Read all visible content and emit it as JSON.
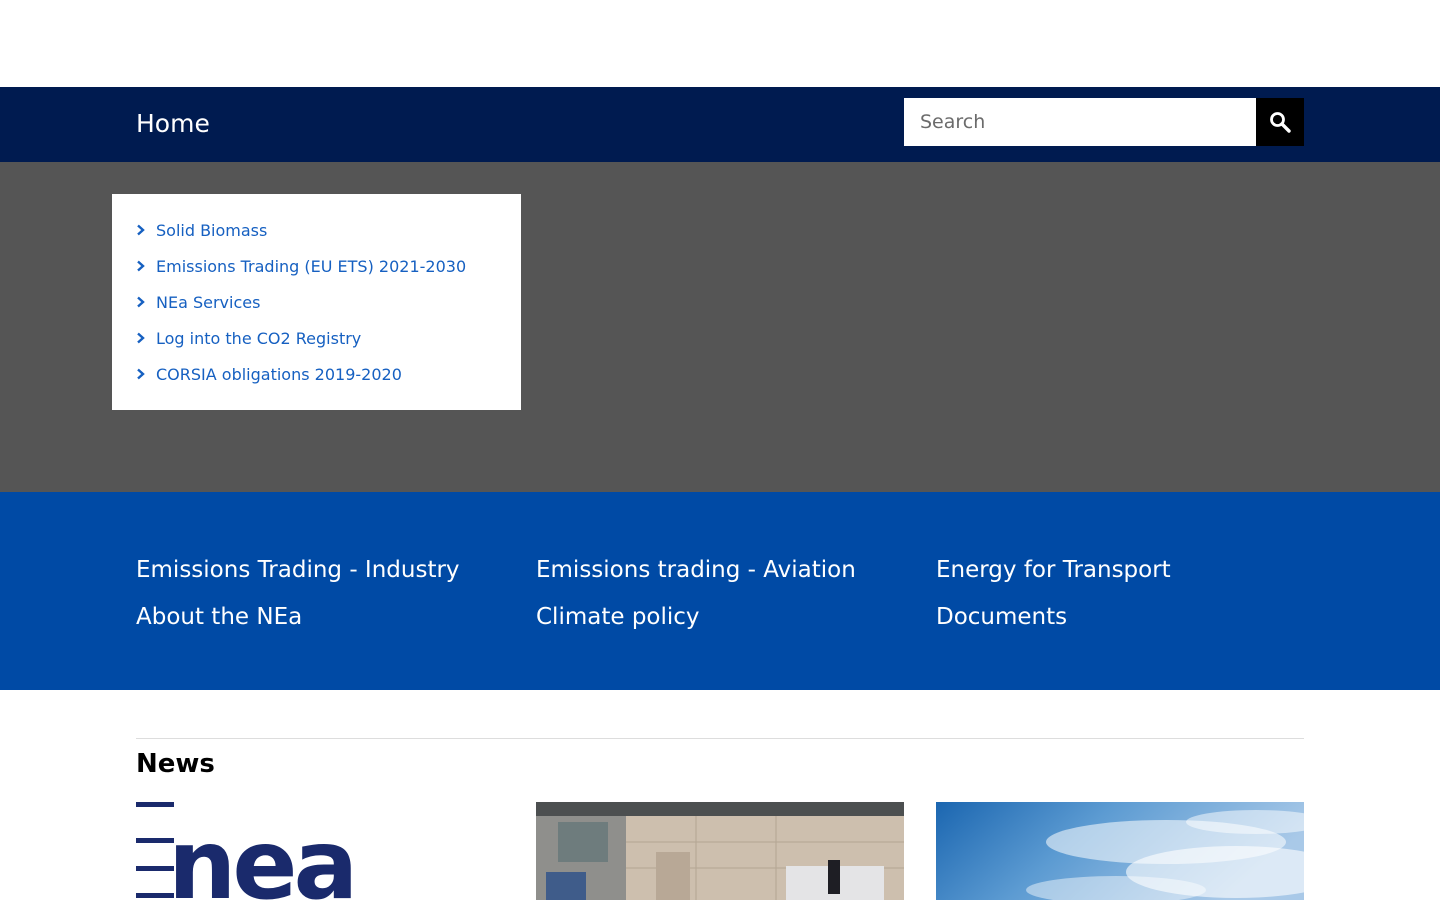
{
  "nav": {
    "home_label": "Home",
    "search_placeholder": "Search"
  },
  "quicklinks": [
    {
      "label": "Solid Biomass"
    },
    {
      "label": "Emissions Trading (EU ETS) 2021-2030"
    },
    {
      "label": "NEa Services"
    },
    {
      "label": "Log into the CO2 Registry"
    },
    {
      "label": "CORSIA obligations 2019-2020"
    }
  ],
  "topics": [
    {
      "label": "Emissions Trading - Industry"
    },
    {
      "label": "Emissions trading - Aviation"
    },
    {
      "label": "Energy for Transport"
    },
    {
      "label": "About the NEa"
    },
    {
      "label": "Climate policy"
    },
    {
      "label": "Documents"
    }
  ],
  "news": {
    "heading": "News",
    "logo_text": "nea"
  },
  "colors": {
    "navbar": "#001b50",
    "hero": "#555555",
    "topics_band": "#004aa5",
    "link": "#1660c1"
  }
}
